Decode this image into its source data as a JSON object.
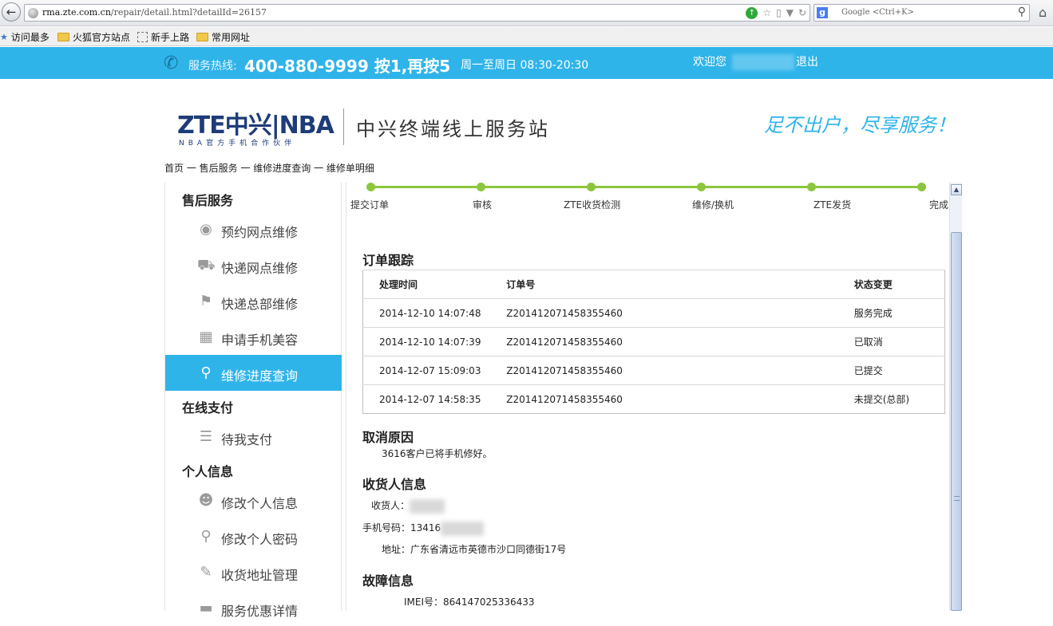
{
  "browser": {
    "back_icon": "back-arrow-icon",
    "url_host": "rma.zte.com.cn",
    "url_path": "/repair/detail.html?detailId=26157",
    "search_placeholder": "Google <Ctrl+K>",
    "bookmarks": [
      "访问最多",
      "火狐官方站点",
      "新手上路",
      "常用网址"
    ]
  },
  "topbar": {
    "hotline_label": "服务热线:",
    "hotline_number": "400-880-9999 按1,再按5",
    "hours": "周一至周日 08:30-20:30",
    "welcome": "欢迎您",
    "logout": "退出"
  },
  "header": {
    "logo_main": "ZTE中兴|NBA",
    "logo_sub": "NBA官方手机合作伙伴",
    "site_title": "中兴终端线上服务站",
    "slogan": "足不出户，尽享服务！"
  },
  "breadcrumb": "首页 一 售后服务 一 维修进度查询 一 维修单明细",
  "sidebar": {
    "section1": "售后服务",
    "items1": [
      "预约网点维修",
      "快递网点维修",
      "快递总部维修",
      "申请手机美容",
      "维修进度查询"
    ],
    "section2": "在线支付",
    "items2": [
      "待我支付"
    ],
    "section3": "个人信息",
    "items3": [
      "修改个人信息",
      "修改个人密码",
      "收货地址管理",
      "服务优惠详情"
    ]
  },
  "progress": {
    "steps": [
      "提交订单",
      "审核",
      "ZTE收货检测",
      "维修/换机",
      "ZTE发货",
      "完成"
    ]
  },
  "tracking": {
    "title": "订单跟踪",
    "headers": [
      "处理时间",
      "订单号",
      "状态变更"
    ],
    "rows": [
      [
        "2014-12-10 14:07:48",
        "Z201412071458355460",
        "服务完成"
      ],
      [
        "2014-12-10 14:07:39",
        "Z201412071458355460",
        "已取消"
      ],
      [
        "2014-12-07 15:09:03",
        "Z201412071458355460",
        "已提交"
      ],
      [
        "2014-12-07 14:58:35",
        "Z201412071458355460",
        "未提交(总部)"
      ]
    ]
  },
  "cancel": {
    "title": "取消原因",
    "text": "3616客户已将手机修好。"
  },
  "receiver": {
    "title": "收货人信息",
    "name_label": "收货人：",
    "phone_label": "手机号码：",
    "phone_value": "13416",
    "address_label": "地址：",
    "address_value": "广东省清远市英德市沙口同德街17号"
  },
  "fault": {
    "title": "故障信息",
    "imei_label": "IMEI号：",
    "imei_value": "864147025336433"
  },
  "colors": {
    "accent": "#2fb4ea",
    "progress": "#8cc63f",
    "brand": "#1e3c78"
  }
}
